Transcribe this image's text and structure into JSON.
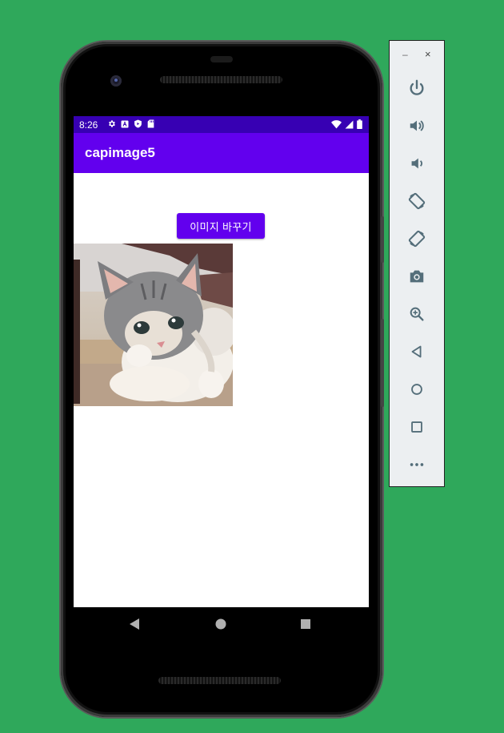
{
  "status_bar": {
    "time": "8:26",
    "left_icons": [
      "settings-icon",
      "a-badge-icon",
      "play-protect-icon",
      "sd-card-icon"
    ],
    "right_icons": [
      "wifi-icon",
      "cell-signal-icon",
      "battery-icon"
    ]
  },
  "app": {
    "title": "capimage5",
    "change_image_button": "이미지 바꾸기",
    "image_semantic": "kitten-photo"
  },
  "nav_bar": {
    "buttons": [
      "back-icon",
      "home-icon",
      "recents-icon"
    ]
  },
  "emulator_panel": {
    "window_controls": [
      "minimize-icon",
      "close-icon"
    ],
    "minimize_glyph": "–",
    "close_glyph": "×",
    "tools": [
      "power-icon",
      "volume-up-icon",
      "volume-down-icon",
      "rotate-left-icon",
      "rotate-right-icon",
      "screenshot-icon",
      "zoom-icon",
      "back-icon",
      "home-icon",
      "overview-icon",
      "more-icon"
    ]
  },
  "colors": {
    "background": "#2fa85b",
    "status_bar": "#3700b3",
    "app_bar": "#6200ee",
    "button": "#6200ee",
    "panel": "#eceff1",
    "panel_icon": "#546e7a"
  }
}
